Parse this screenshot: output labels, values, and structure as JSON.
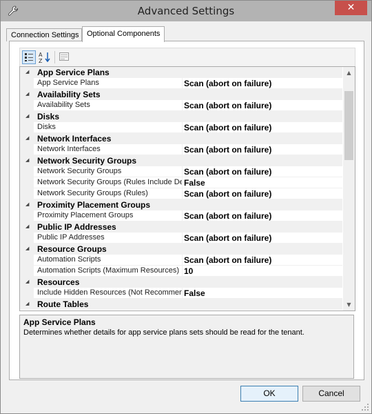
{
  "window": {
    "title": "Advanced Settings",
    "close_glyph": "✕",
    "icon": "wrench-icon"
  },
  "tabs": [
    {
      "label": "Connection Settings",
      "selected": false
    },
    {
      "label": "Optional Components",
      "selected": true
    }
  ],
  "toolbar": {
    "categorized_icon": "categorized-view-icon",
    "alphabetical_icon": "alphabetical-sort-icon",
    "property_pages_icon": "property-pages-icon",
    "alphabetical_label": "AZ"
  },
  "grid": {
    "rows": [
      {
        "type": "category",
        "label": "App Service Plans"
      },
      {
        "type": "property",
        "name": "App Service Plans",
        "value": "Scan (abort on failure)"
      },
      {
        "type": "category",
        "label": "Availability Sets"
      },
      {
        "type": "property",
        "name": "Availability Sets",
        "value": "Scan (abort on failure)"
      },
      {
        "type": "category",
        "label": "Disks"
      },
      {
        "type": "property",
        "name": "Disks",
        "value": "Scan (abort on failure)"
      },
      {
        "type": "category",
        "label": "Network Interfaces"
      },
      {
        "type": "property",
        "name": "Network Interfaces",
        "value": "Scan (abort on failure)"
      },
      {
        "type": "category",
        "label": "Network Security Groups"
      },
      {
        "type": "property",
        "name": "Network Security Groups",
        "value": "Scan (abort on failure)"
      },
      {
        "type": "property",
        "name": "Network Security Groups (Rules Include Defaults)",
        "value": "False"
      },
      {
        "type": "property",
        "name": "Network Security Groups (Rules)",
        "value": "Scan (abort on failure)"
      },
      {
        "type": "category",
        "label": "Proximity Placement Groups"
      },
      {
        "type": "property",
        "name": "Proximity Placement Groups",
        "value": "Scan (abort on failure)"
      },
      {
        "type": "category",
        "label": "Public IP Addresses"
      },
      {
        "type": "property",
        "name": "Public IP Addresses",
        "value": "Scan (abort on failure)"
      },
      {
        "type": "category",
        "label": "Resource Groups"
      },
      {
        "type": "property",
        "name": "Automation Scripts",
        "value": "Scan (abort on failure)"
      },
      {
        "type": "property",
        "name": "Automation Scripts (Maximum Resources)",
        "value": "10"
      },
      {
        "type": "category",
        "label": "Resources"
      },
      {
        "type": "property",
        "name": "Include Hidden Resources (Not Recommended)",
        "value": "False"
      },
      {
        "type": "category",
        "label": "Route Tables"
      }
    ],
    "collapse_glyph": "◢",
    "scroll_position": 0.08
  },
  "description": {
    "title": "App Service Plans",
    "text": "Determines whether details for app service plans sets should be read for the tenant."
  },
  "buttons": {
    "ok": "OK",
    "cancel": "Cancel"
  }
}
